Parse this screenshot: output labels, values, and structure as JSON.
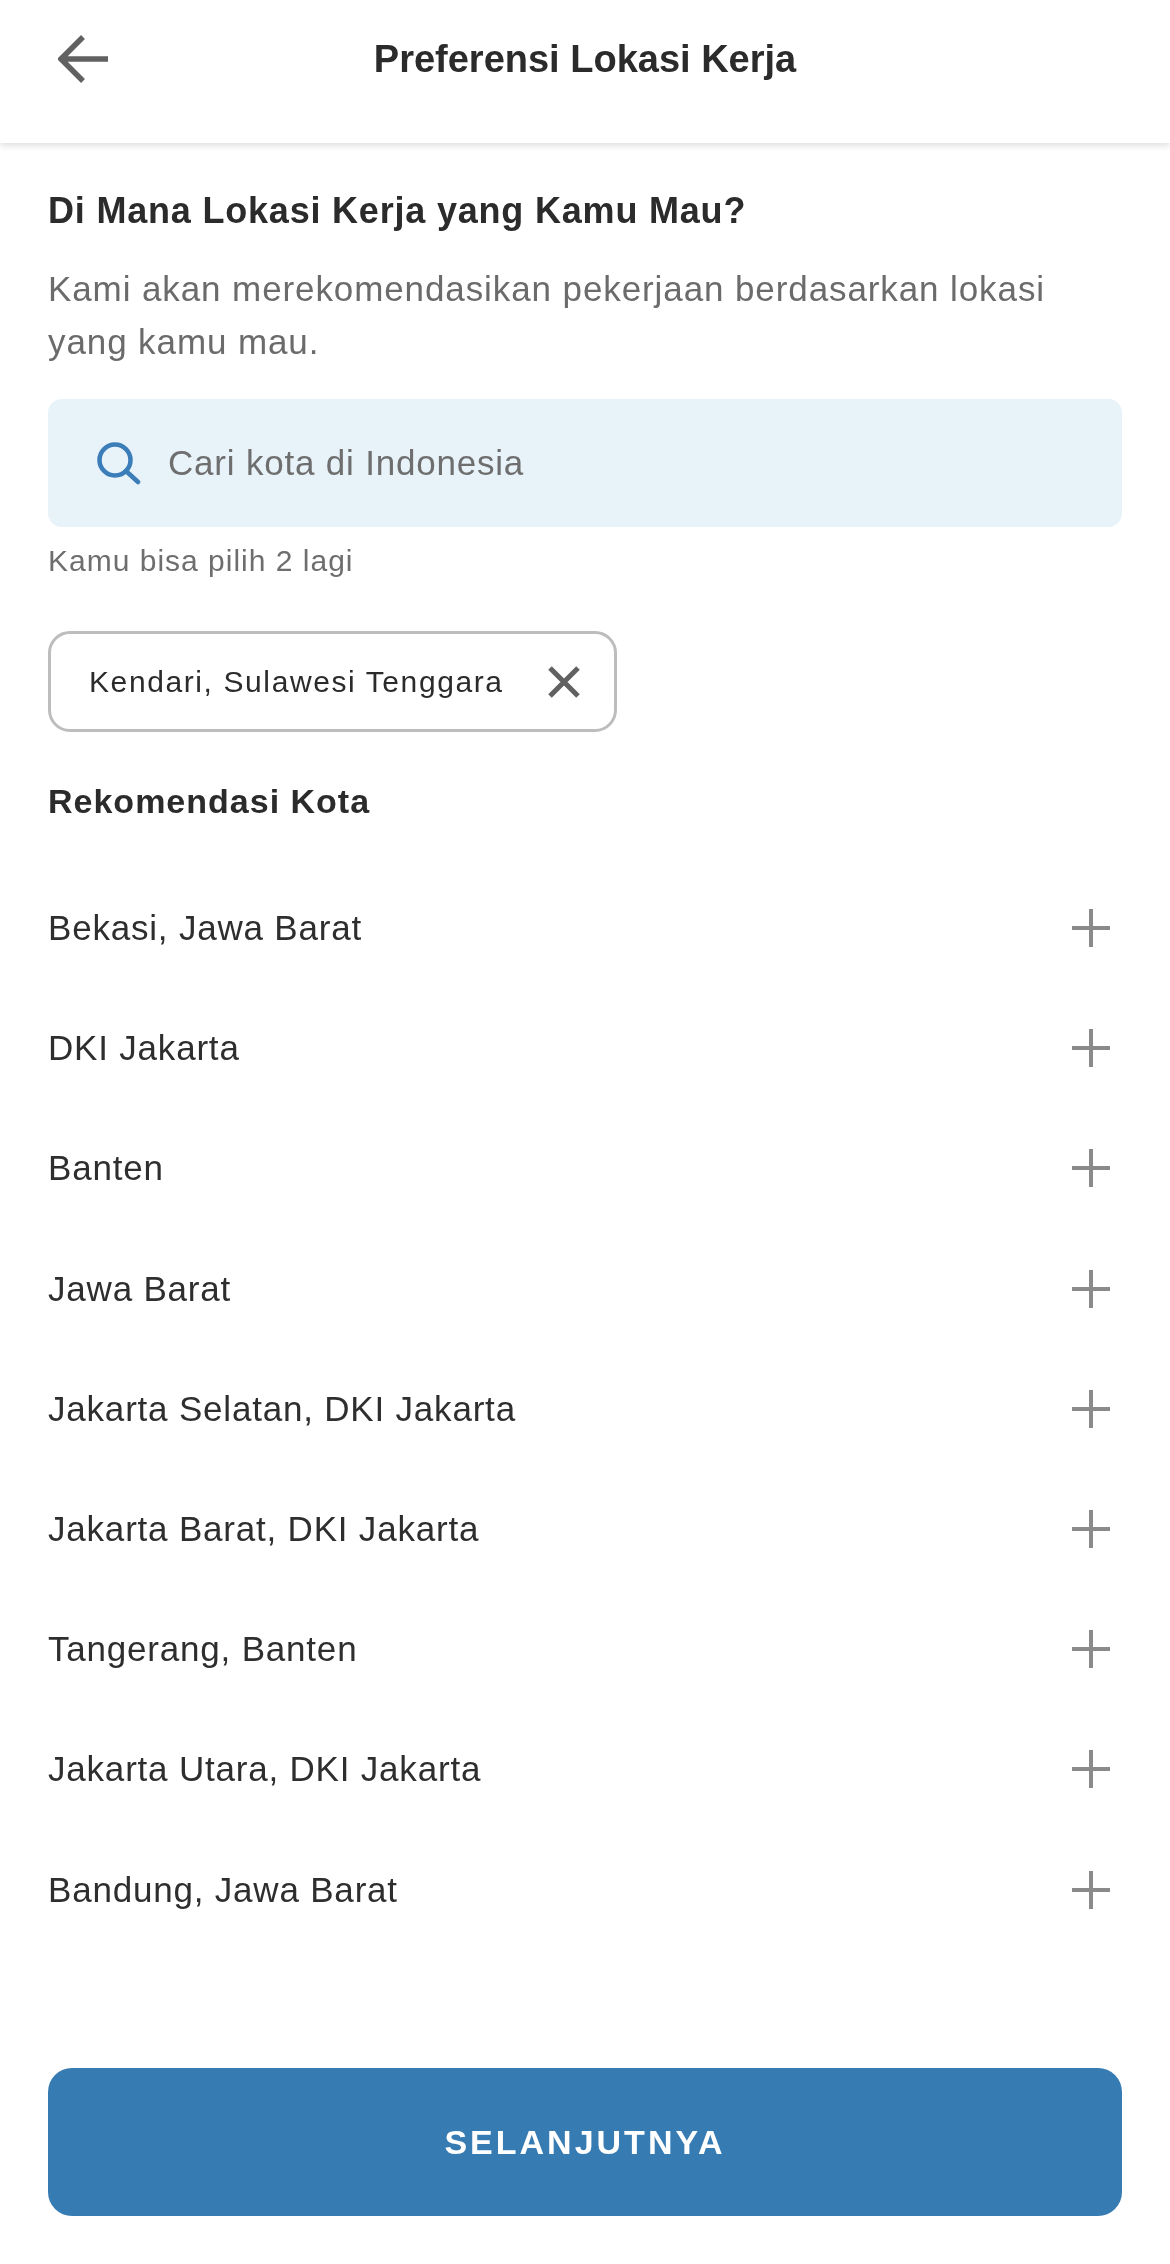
{
  "header": {
    "title": "Preferensi Lokasi Kerja"
  },
  "intro": {
    "heading": "Di Mana Lokasi Kerja yang Kamu Mau?",
    "description": "Kami akan merekomendasikan pekerjaan berdasarkan lokasi yang kamu mau."
  },
  "search": {
    "placeholder": "Cari kota di Indonesia",
    "hint": "Kamu bisa pilih 2 lagi"
  },
  "selected_locations": [
    {
      "label": "Kendari, Sulawesi Tenggara"
    }
  ],
  "recommendations": {
    "title": "Rekomendasi Kota",
    "items": [
      {
        "label": "Bekasi, Jawa Barat"
      },
      {
        "label": "DKI Jakarta"
      },
      {
        "label": "Banten"
      },
      {
        "label": "Jawa Barat"
      },
      {
        "label": "Jakarta Selatan, DKI Jakarta"
      },
      {
        "label": "Jakarta Barat, DKI Jakarta"
      },
      {
        "label": "Tangerang, Banten"
      },
      {
        "label": "Jakarta Utara, DKI Jakarta"
      },
      {
        "label": "Bandung, Jawa Barat"
      }
    ]
  },
  "next_button": {
    "label": "SELANJUTNYA"
  }
}
